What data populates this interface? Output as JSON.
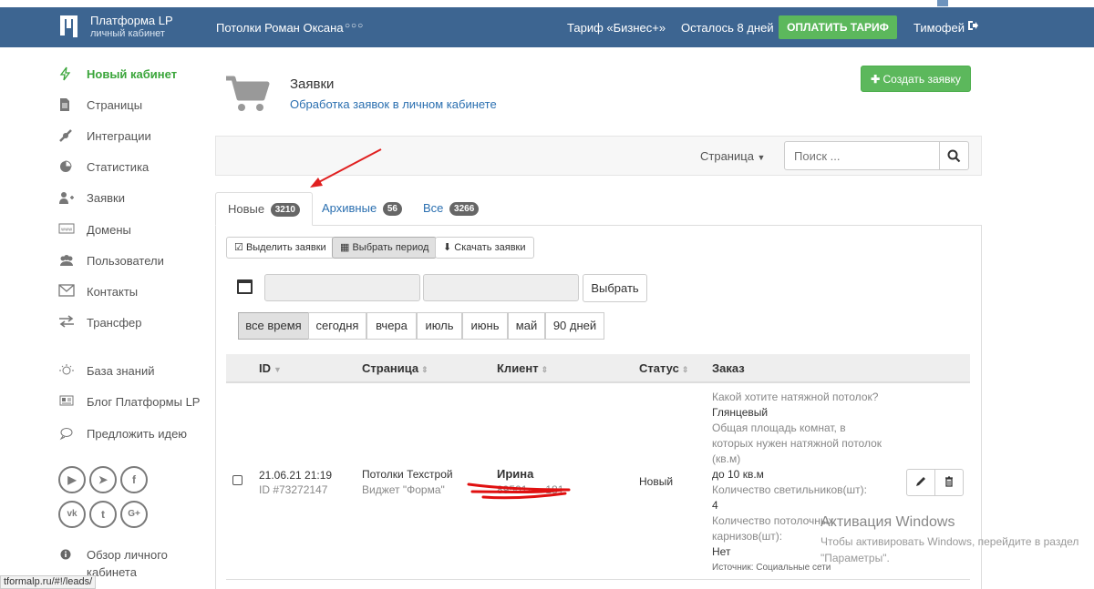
{
  "topbar": {
    "brand": "Платформа LP",
    "brand_sub": "личный кабинет",
    "project": "Потолки Роман Оксана",
    "dots": "○○○",
    "tariff": "Тариф «Бизнес+»",
    "remaining": "Осталось 8 дней",
    "pay_button": "ОПЛАТИТЬ ТАРИФ",
    "user": "Тимофей",
    "colors": {
      "bar": "#3d6591",
      "pay": "#5cb85c"
    }
  },
  "sidebar": {
    "items": [
      {
        "label": "Новый кабинет",
        "icon": "bolt-icon",
        "active": true
      },
      {
        "label": "Страницы",
        "icon": "file-icon"
      },
      {
        "label": "Интеграции",
        "icon": "plug-icon"
      },
      {
        "label": "Статистика",
        "icon": "pie-chart-icon"
      },
      {
        "label": "Заявки",
        "icon": "user-plus-icon"
      },
      {
        "label": "Домены",
        "icon": "www-icon"
      },
      {
        "label": "Пользователи",
        "icon": "users-icon"
      },
      {
        "label": "Контакты",
        "icon": "envelope-icon"
      },
      {
        "label": "Трансфер",
        "icon": "transfer-icon"
      }
    ],
    "extra": [
      {
        "label": "База знаний",
        "icon": "lightbulb-icon"
      },
      {
        "label": "Блог Платформы LP",
        "icon": "newspaper-icon"
      },
      {
        "label": "Предложить идею",
        "icon": "chat-bubble-icon"
      }
    ],
    "social": [
      "youtube-icon",
      "telegram-icon",
      "facebook-icon",
      "vk-icon",
      "twitter-icon",
      "google-plus-icon"
    ],
    "social_glyphs": [
      "▶",
      "➤",
      "f",
      "vk",
      "t",
      "G+"
    ],
    "overview": "Обзор личного кабинета",
    "overview_line1": "Обзор личного",
    "overview_line2": "кабинета"
  },
  "header": {
    "title": "Заявки",
    "subtitle": "Обработка заявок в личном кабинете",
    "create_button": "Создать заявку"
  },
  "toolbar": {
    "page_label": "Страница",
    "search_placeholder": "Поиск ..."
  },
  "tabs": [
    {
      "label": "Новые",
      "count": "3210",
      "active": true
    },
    {
      "label": "Архивные",
      "count": "56"
    },
    {
      "label": "Все",
      "count": "3266"
    }
  ],
  "actions": {
    "select": "Выделить заявки",
    "period": "Выбрать период",
    "download": "Скачать заявки",
    "pick": "Выбрать"
  },
  "periods": [
    "все время",
    "сегодня",
    "вчера",
    "июль",
    "июнь",
    "май",
    "90 дней"
  ],
  "table": {
    "headers": {
      "id": "ID",
      "page": "Страница",
      "client": "Клиент",
      "status": "Статус",
      "order": "Заказ"
    },
    "rows": [
      {
        "date": "21.06.21 21:19",
        "id": "ID #73272147",
        "page": "Потолки Техстрой",
        "widget": "Виджет \"Форма\"",
        "client_name": "Ирина",
        "client_phone": "89501·····181",
        "status": "Новый",
        "order": [
          {
            "q": "Какой хотите натяжной потолок?",
            "a": "Глянцевый"
          },
          {
            "q": "Общая площадь комнат, в которых нужен натяжной потолок (кв.м)",
            "a": "до 10 кв.м"
          },
          {
            "q": "Количество светильников(шт):",
            "a": "4"
          },
          {
            "q": "Количество потолочных карнизов(шт):",
            "a": "Нет"
          }
        ],
        "source": "Источник: Социальные сети"
      }
    ]
  },
  "watermark": {
    "title": "Активация Windows",
    "line1": "Чтобы активировать Windows, перейдите в раздел",
    "line2": "\"Параметры\"."
  },
  "status_url": "tformalp.ru/#!/leads/"
}
